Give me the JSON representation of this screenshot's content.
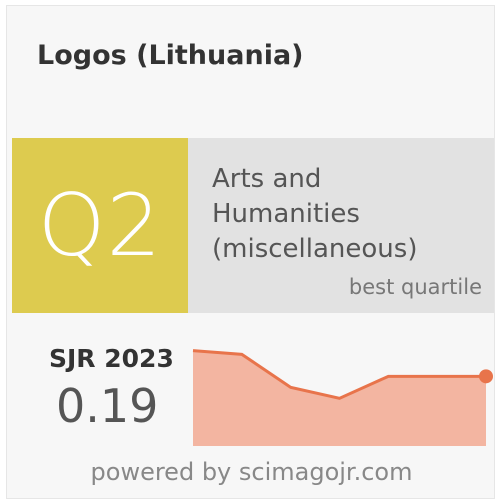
{
  "journal": {
    "title": "Logos (Lithuania)"
  },
  "quartile": {
    "value": "Q2",
    "category": [
      "Arts and",
      "Humanities",
      "(miscellaneous)"
    ],
    "caption": "best quartile"
  },
  "sjr": {
    "label": "SJR 2023",
    "value": "0.19"
  },
  "colors": {
    "quartile_bg": "#ddcb4f",
    "category_bg": "#e2e2e2",
    "trend_fill": "#f3b5a1",
    "trend_line": "#e8744b",
    "trend_point": "#e8744b"
  },
  "chart_data": {
    "type": "area",
    "values": [
      0.26,
      0.25,
      0.16,
      0.13,
      0.19,
      0.19,
      0.19
    ],
    "ylim": [
      0,
      0.3
    ],
    "highlight_last_point": true
  },
  "footer": {
    "text": "powered by scimagojr.com"
  }
}
